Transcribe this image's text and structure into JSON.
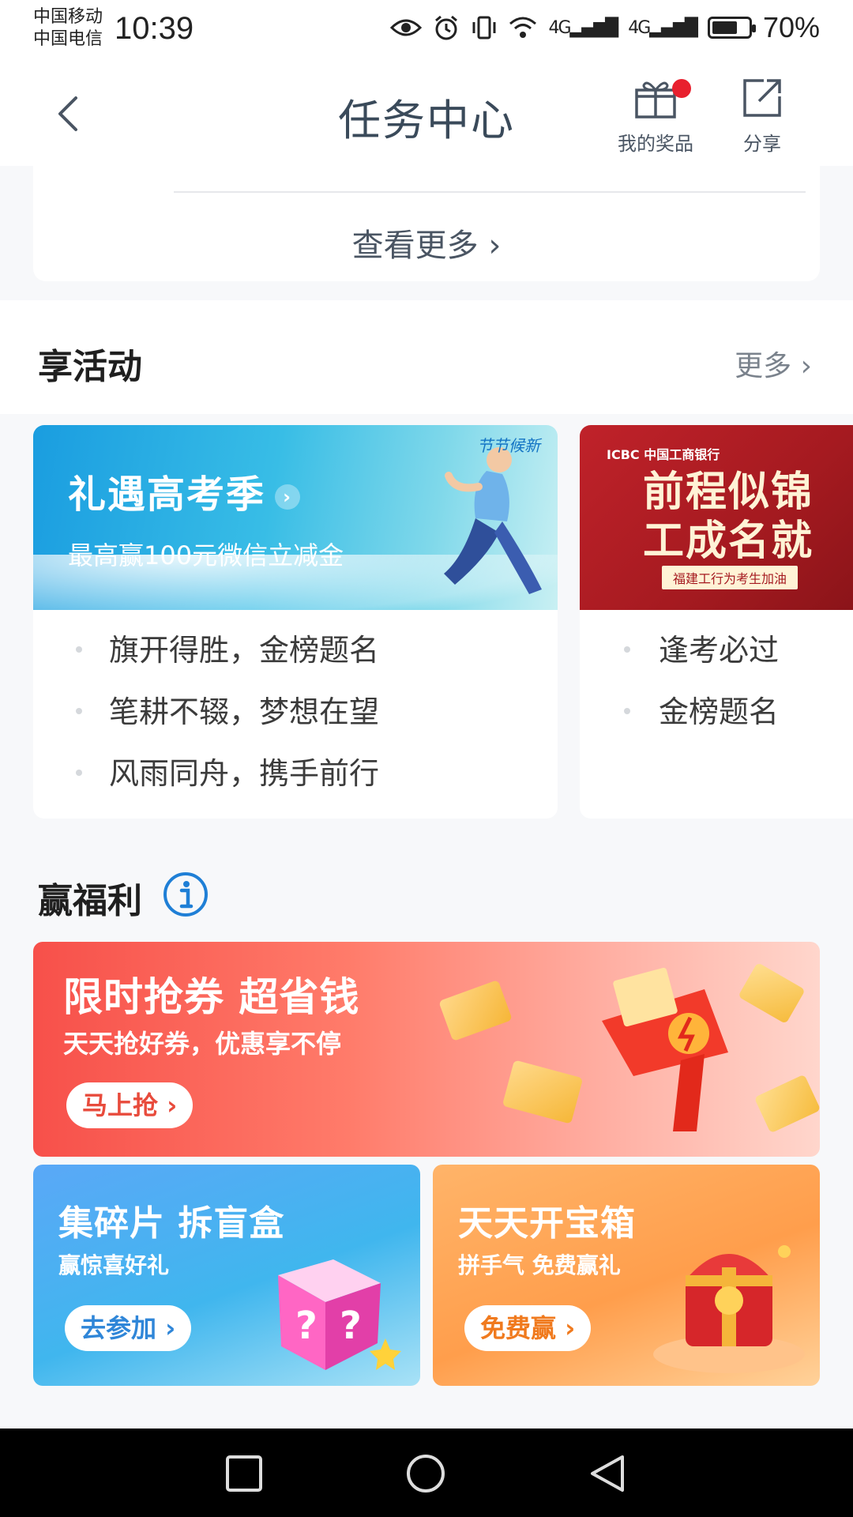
{
  "status_bar": {
    "carrier_1": "中国移动",
    "carrier_2": "中国电信",
    "time": "10:39",
    "network_1": "4G",
    "network_2": "4G",
    "battery_level": 0.7,
    "battery_text": "70%"
  },
  "header": {
    "title": "任务中心",
    "prizes_label": "我的奖品",
    "share_label": "分享"
  },
  "top_card": {
    "view_more": "查看更多"
  },
  "activities": {
    "title": "享活动",
    "more_label": "更多",
    "cards": [
      {
        "banner_title": "礼遇高考季",
        "banner_subtitle": "最高赢100元微信立减金",
        "banner_tag": "节节候新",
        "items": [
          "旗开得胜，金榜题名",
          "笔耕不辍，梦想在望",
          "风雨同舟，携手前行"
        ]
      },
      {
        "banner_brand": "ICBC 中国工商银行",
        "banner_line_1": "前程似锦",
        "banner_line_2": "工成名就",
        "banner_pill": "福建工行为考生加油",
        "items": [
          "逢考必过",
          "金榜题名"
        ]
      }
    ]
  },
  "welfare": {
    "title": "赢福利",
    "promos": [
      {
        "title": "限时抢券 超省钱",
        "subtitle": "天天抢好券，优惠享不停",
        "button": "马上抢 ›"
      },
      {
        "title": "集碎片 拆盲盒",
        "subtitle": "赢惊喜好礼",
        "button": "去参加 ›"
      },
      {
        "title": "天天开宝箱",
        "subtitle": "拼手气 免费赢礼",
        "button": "免费赢 ›"
      }
    ]
  },
  "colors": {
    "accent_red": "#e8202e",
    "nav_text": "#3a4a5a",
    "info_blue": "#1f7fd6"
  }
}
